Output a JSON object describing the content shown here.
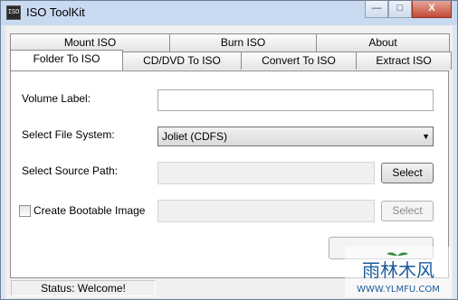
{
  "window": {
    "title": "ISO ToolKit",
    "icon": "iso-app-icon"
  },
  "window_controls": {
    "minimize": "—",
    "maximize": "□",
    "close": "X"
  },
  "tabs_back": [
    {
      "label": "Mount ISO"
    },
    {
      "label": "Burn ISO"
    },
    {
      "label": "About"
    }
  ],
  "tabs_front": [
    {
      "label": "Folder To ISO",
      "active": true
    },
    {
      "label": "CD/DVD To ISO"
    },
    {
      "label": "Convert To ISO"
    },
    {
      "label": "Extract ISO"
    }
  ],
  "form": {
    "volume_label": "Volume Label:",
    "volume_value": "",
    "file_system_label": "Select File System:",
    "file_system_value": "Joliet (CDFS)",
    "source_path_label": "Select Source Path:",
    "source_path_value": "",
    "select_button": "Select",
    "bootable_label": "Create Bootable Image",
    "bootable_checked": false,
    "bootable_value": "",
    "bootable_select_button": "Select"
  },
  "status": {
    "text": "Status: Welcome!"
  },
  "watermark": {
    "site": "雨林木风",
    "url": "WWW.YLMFU.COM"
  }
}
